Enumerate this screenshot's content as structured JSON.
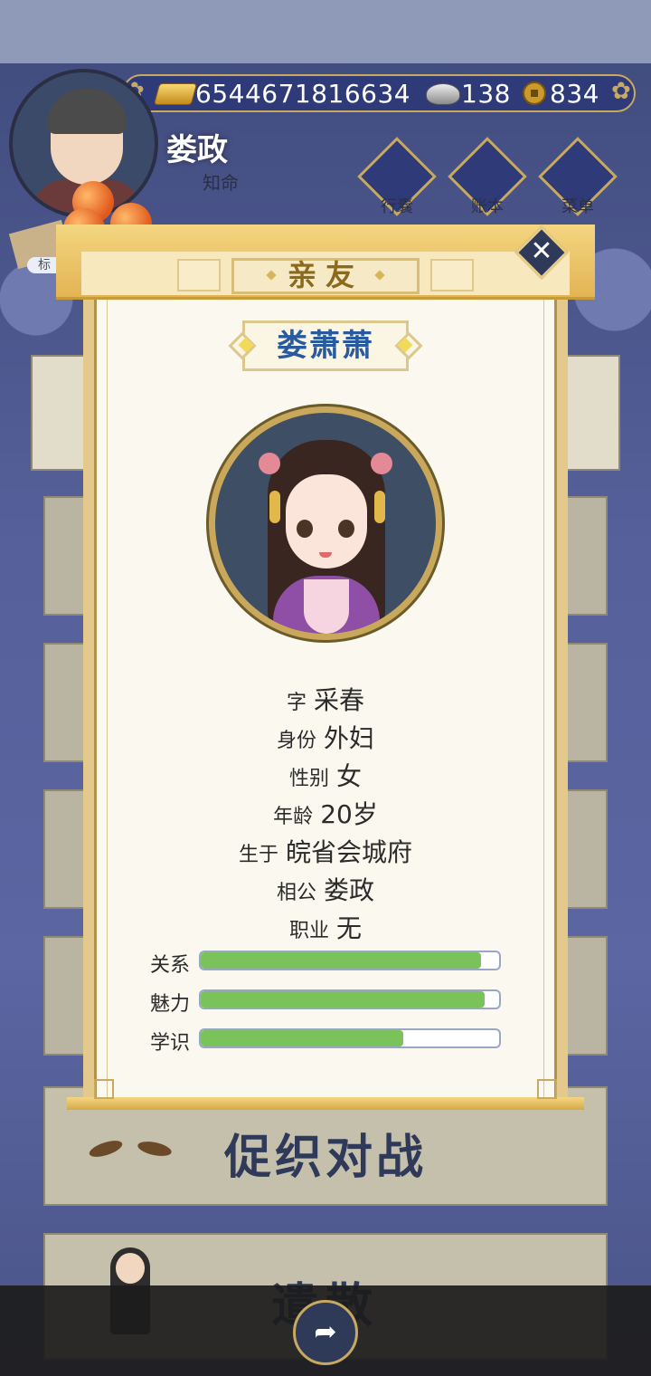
{
  "header": {
    "gold": "6544671816634",
    "silver": "138",
    "coins": "834",
    "player_name": "娄政",
    "player_rank": "知命",
    "menu": [
      {
        "label": "行囊",
        "icon": "bag-icon"
      },
      {
        "label": "账本",
        "icon": "ledger-icon"
      },
      {
        "label": "菜单",
        "icon": "more-icon"
      }
    ],
    "mark_label": "标"
  },
  "modal": {
    "title": "亲友",
    "person_name": "娄萧萧",
    "info": [
      {
        "label": "字",
        "value": "采春"
      },
      {
        "label": "身份",
        "value": "外妇"
      },
      {
        "label": "性别",
        "value": "女"
      },
      {
        "label": "年龄",
        "value": "20岁"
      },
      {
        "label": "生于",
        "value": "皖省会城府"
      },
      {
        "label": "相公",
        "value": "娄政"
      },
      {
        "label": "职业",
        "value": "无"
      }
    ],
    "stats": [
      {
        "label": "关系",
        "percent": 94
      },
      {
        "label": "魅力",
        "percent": 95
      },
      {
        "label": "学识",
        "percent": 68
      }
    ]
  },
  "background": {
    "battle_label": "促织对战",
    "bottom_label": "遣散"
  },
  "colors": {
    "accent_gold": "#c7a960",
    "bar_fill": "#7ac25a",
    "name_blue": "#2a5a9e"
  }
}
